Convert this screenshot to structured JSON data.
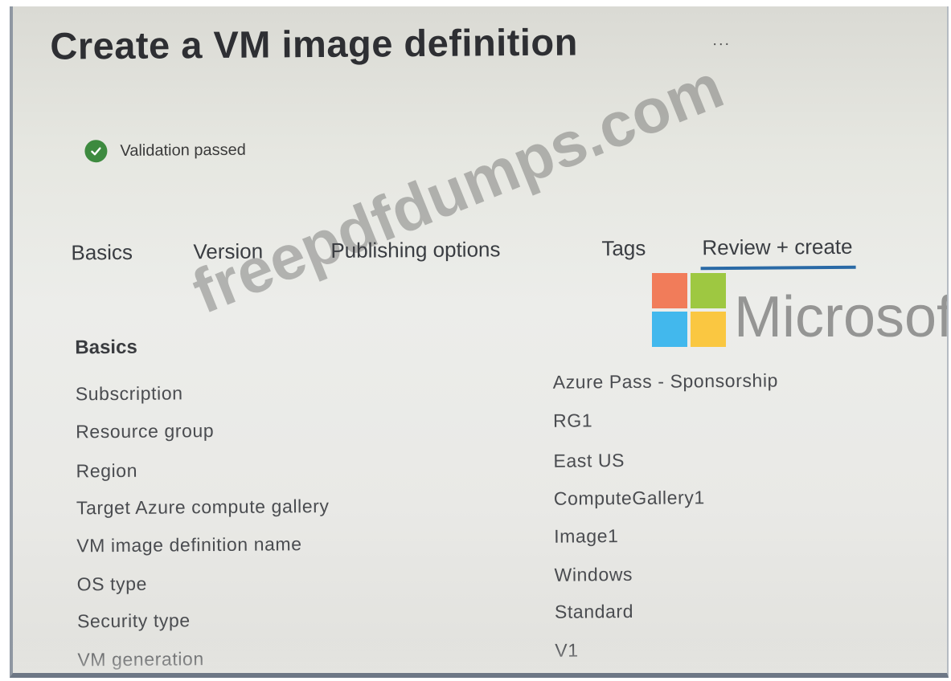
{
  "header": {
    "title": "Create a VM image definition",
    "more_label": "..."
  },
  "validation": {
    "text": "Validation passed",
    "status_color": "#3d8a3f"
  },
  "tabs": [
    {
      "label": "Basics",
      "active": false
    },
    {
      "label": "Version",
      "active": false
    },
    {
      "label": "Publishing options",
      "active": false
    },
    {
      "label": "Tags",
      "active": false
    },
    {
      "label": "Review + create",
      "active": true
    }
  ],
  "section": {
    "title": "Basics",
    "fields": [
      {
        "label": "Subscription",
        "value": "Azure Pass - Sponsorship"
      },
      {
        "label": "Resource group",
        "value": "RG1"
      },
      {
        "label": "Region",
        "value": "East US"
      },
      {
        "label": "Target Azure compute gallery",
        "value": "ComputeGallery1"
      },
      {
        "label": "VM image definition name",
        "value": "Image1"
      },
      {
        "label": "OS type",
        "value": "Windows"
      },
      {
        "label": "Security type",
        "value": "Standard"
      },
      {
        "label": "VM generation",
        "value": "V1"
      }
    ]
  },
  "watermark": {
    "site_text": "freepdfdumps.com",
    "brand_text": "Microsoft",
    "logo_colors": [
      "#f25022",
      "#7fba00",
      "#00a4ef",
      "#ffb900"
    ]
  },
  "accent_color": "#2a6aa6"
}
